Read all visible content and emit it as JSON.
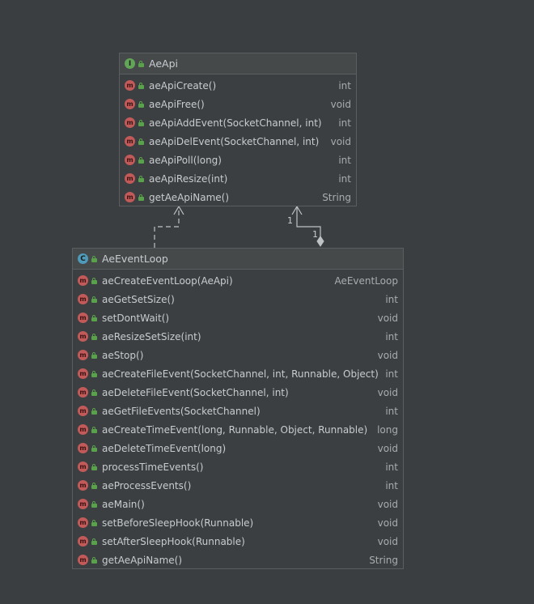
{
  "interface_box": {
    "badge": "I",
    "name": "AeApi",
    "methods": [
      {
        "name": "aeApiCreate()",
        "type": "int"
      },
      {
        "name": "aeApiFree()",
        "type": "void"
      },
      {
        "name": "aeApiAddEvent(SocketChannel, int)",
        "type": "int"
      },
      {
        "name": "aeApiDelEvent(SocketChannel, int)",
        "type": "void"
      },
      {
        "name": "aeApiPoll(long)",
        "type": "int"
      },
      {
        "name": "aeApiResize(int)",
        "type": "int"
      },
      {
        "name": "getAeApiName()",
        "type": "String"
      }
    ]
  },
  "class_box": {
    "badge": "C",
    "name": "AeEventLoop",
    "methods": [
      {
        "name": "aeCreateEventLoop(AeApi)",
        "type": "AeEventLoop"
      },
      {
        "name": "aeGetSetSize()",
        "type": "int"
      },
      {
        "name": "setDontWait()",
        "type": "void"
      },
      {
        "name": "aeResizeSetSize(int)",
        "type": "int"
      },
      {
        "name": "aeStop()",
        "type": "void"
      },
      {
        "name": "aeCreateFileEvent(SocketChannel, int, Runnable, Object)",
        "type": "int"
      },
      {
        "name": "aeDeleteFileEvent(SocketChannel, int)",
        "type": "void"
      },
      {
        "name": "aeGetFileEvents(SocketChannel)",
        "type": "int"
      },
      {
        "name": "aeCreateTimeEvent(long, Runnable, Object, Runnable)",
        "type": "long"
      },
      {
        "name": "aeDeleteTimeEvent(long)",
        "type": "void"
      },
      {
        "name": "processTimeEvents()",
        "type": "int"
      },
      {
        "name": "aeProcessEvents()",
        "type": "int"
      },
      {
        "name": "aeMain()",
        "type": "void"
      },
      {
        "name": "setBeforeSleepHook(Runnable)",
        "type": "void"
      },
      {
        "name": "setAfterSleepHook(Runnable)",
        "type": "void"
      },
      {
        "name": "getAeApiName()",
        "type": "String"
      }
    ]
  },
  "method_badge": "m",
  "association": {
    "source_multiplicity": "1",
    "target_multiplicity": "1"
  },
  "colors": {
    "background": "#3b3e40",
    "interface_badge": "#62a558",
    "class_badge": "#4e9ab8",
    "method_badge": "#c25a5a",
    "lines": "#c9cccf"
  }
}
